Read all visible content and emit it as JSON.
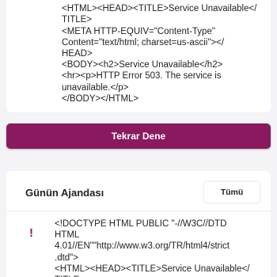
{
  "error_card": {
    "raw_text": ".dtd\">\n<HTML><HEAD><TITLE>Service Unavailable</\nTITLE>\n<META HTTP-EQUIV=\"Content-Type\"\nContent=\"text/html; charset=us-ascii\"></\nHEAD>\n<BODY><h2>Service Unavailable</h2>\n<hr><p>HTTP Error 503. The service is\nunavailable.</p>\n</BODY></HTML>"
  },
  "retry_button": {
    "label": "Tekrar Dene"
  },
  "agenda": {
    "title": "Günün Ajandası",
    "all_label": "Tümü",
    "alert_icon": "!",
    "item_text": "<!DOCTYPE HTML PUBLIC \"-//W3C//DTD\nHTML\n4.01//EN\"\"http://www.w3.org/TR/html4/strict\n.dtd\">\n<HTML><HEAD><TITLE>Service Unavailable</\nTITLE>"
  },
  "colors": {
    "accent": "#8a1a60",
    "background": "#f4f4f6",
    "card": "#ffffff"
  }
}
